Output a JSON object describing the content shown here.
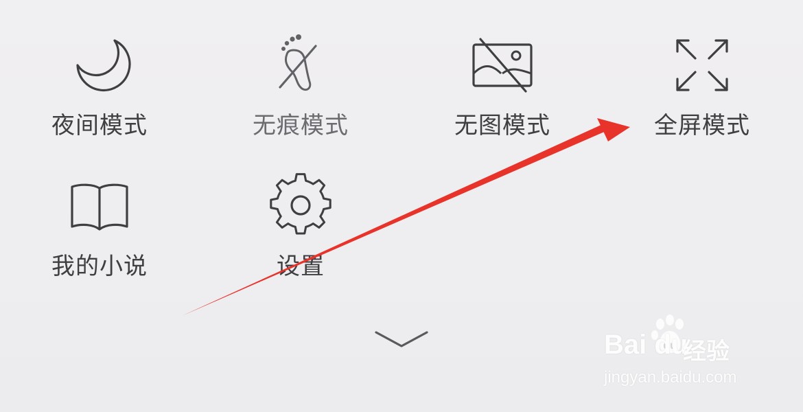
{
  "menu": {
    "row1": [
      {
        "label": "夜间模式",
        "icon": "moon-icon"
      },
      {
        "label": "无痕模式",
        "icon": "footprint-crossed-icon"
      },
      {
        "label": "无图模式",
        "icon": "image-crossed-icon"
      },
      {
        "label": "全屏模式",
        "icon": "fullscreen-expand-icon"
      }
    ],
    "row2": [
      {
        "label": "我的小说",
        "icon": "open-book-icon"
      },
      {
        "label": "设置",
        "icon": "gear-icon"
      }
    ],
    "collapse_icon": "chevron-down-icon"
  },
  "annotation": {
    "color": "#e8332b",
    "points_to": "全屏模式"
  },
  "watermark": {
    "brand": "Bai  du",
    "product": "经验",
    "url": "jingyan.baidu.com"
  }
}
